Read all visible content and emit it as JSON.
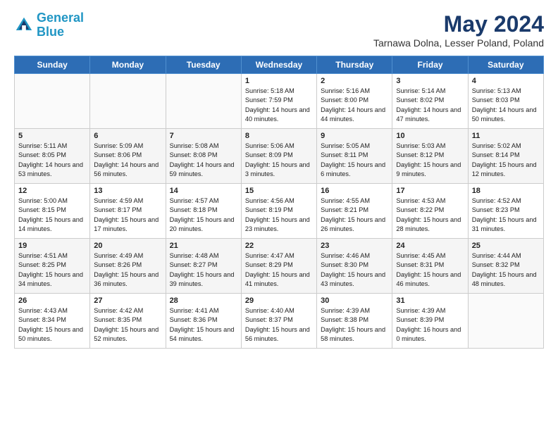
{
  "logo": {
    "line1": "General",
    "line2": "Blue"
  },
  "title": "May 2024",
  "location": "Tarnawa Dolna, Lesser Poland, Poland",
  "days_header": [
    "Sunday",
    "Monday",
    "Tuesday",
    "Wednesday",
    "Thursday",
    "Friday",
    "Saturday"
  ],
  "weeks": [
    [
      {
        "num": "",
        "sunrise": "",
        "sunset": "",
        "daylight": ""
      },
      {
        "num": "",
        "sunrise": "",
        "sunset": "",
        "daylight": ""
      },
      {
        "num": "",
        "sunrise": "",
        "sunset": "",
        "daylight": ""
      },
      {
        "num": "1",
        "sunrise": "Sunrise: 5:18 AM",
        "sunset": "Sunset: 7:59 PM",
        "daylight": "Daylight: 14 hours and 40 minutes."
      },
      {
        "num": "2",
        "sunrise": "Sunrise: 5:16 AM",
        "sunset": "Sunset: 8:00 PM",
        "daylight": "Daylight: 14 hours and 44 minutes."
      },
      {
        "num": "3",
        "sunrise": "Sunrise: 5:14 AM",
        "sunset": "Sunset: 8:02 PM",
        "daylight": "Daylight: 14 hours and 47 minutes."
      },
      {
        "num": "4",
        "sunrise": "Sunrise: 5:13 AM",
        "sunset": "Sunset: 8:03 PM",
        "daylight": "Daylight: 14 hours and 50 minutes."
      }
    ],
    [
      {
        "num": "5",
        "sunrise": "Sunrise: 5:11 AM",
        "sunset": "Sunset: 8:05 PM",
        "daylight": "Daylight: 14 hours and 53 minutes."
      },
      {
        "num": "6",
        "sunrise": "Sunrise: 5:09 AM",
        "sunset": "Sunset: 8:06 PM",
        "daylight": "Daylight: 14 hours and 56 minutes."
      },
      {
        "num": "7",
        "sunrise": "Sunrise: 5:08 AM",
        "sunset": "Sunset: 8:08 PM",
        "daylight": "Daylight: 14 hours and 59 minutes."
      },
      {
        "num": "8",
        "sunrise": "Sunrise: 5:06 AM",
        "sunset": "Sunset: 8:09 PM",
        "daylight": "Daylight: 15 hours and 3 minutes."
      },
      {
        "num": "9",
        "sunrise": "Sunrise: 5:05 AM",
        "sunset": "Sunset: 8:11 PM",
        "daylight": "Daylight: 15 hours and 6 minutes."
      },
      {
        "num": "10",
        "sunrise": "Sunrise: 5:03 AM",
        "sunset": "Sunset: 8:12 PM",
        "daylight": "Daylight: 15 hours and 9 minutes."
      },
      {
        "num": "11",
        "sunrise": "Sunrise: 5:02 AM",
        "sunset": "Sunset: 8:14 PM",
        "daylight": "Daylight: 15 hours and 12 minutes."
      }
    ],
    [
      {
        "num": "12",
        "sunrise": "Sunrise: 5:00 AM",
        "sunset": "Sunset: 8:15 PM",
        "daylight": "Daylight: 15 hours and 14 minutes."
      },
      {
        "num": "13",
        "sunrise": "Sunrise: 4:59 AM",
        "sunset": "Sunset: 8:17 PM",
        "daylight": "Daylight: 15 hours and 17 minutes."
      },
      {
        "num": "14",
        "sunrise": "Sunrise: 4:57 AM",
        "sunset": "Sunset: 8:18 PM",
        "daylight": "Daylight: 15 hours and 20 minutes."
      },
      {
        "num": "15",
        "sunrise": "Sunrise: 4:56 AM",
        "sunset": "Sunset: 8:19 PM",
        "daylight": "Daylight: 15 hours and 23 minutes."
      },
      {
        "num": "16",
        "sunrise": "Sunrise: 4:55 AM",
        "sunset": "Sunset: 8:21 PM",
        "daylight": "Daylight: 15 hours and 26 minutes."
      },
      {
        "num": "17",
        "sunrise": "Sunrise: 4:53 AM",
        "sunset": "Sunset: 8:22 PM",
        "daylight": "Daylight: 15 hours and 28 minutes."
      },
      {
        "num": "18",
        "sunrise": "Sunrise: 4:52 AM",
        "sunset": "Sunset: 8:23 PM",
        "daylight": "Daylight: 15 hours and 31 minutes."
      }
    ],
    [
      {
        "num": "19",
        "sunrise": "Sunrise: 4:51 AM",
        "sunset": "Sunset: 8:25 PM",
        "daylight": "Daylight: 15 hours and 34 minutes."
      },
      {
        "num": "20",
        "sunrise": "Sunrise: 4:49 AM",
        "sunset": "Sunset: 8:26 PM",
        "daylight": "Daylight: 15 hours and 36 minutes."
      },
      {
        "num": "21",
        "sunrise": "Sunrise: 4:48 AM",
        "sunset": "Sunset: 8:27 PM",
        "daylight": "Daylight: 15 hours and 39 minutes."
      },
      {
        "num": "22",
        "sunrise": "Sunrise: 4:47 AM",
        "sunset": "Sunset: 8:29 PM",
        "daylight": "Daylight: 15 hours and 41 minutes."
      },
      {
        "num": "23",
        "sunrise": "Sunrise: 4:46 AM",
        "sunset": "Sunset: 8:30 PM",
        "daylight": "Daylight: 15 hours and 43 minutes."
      },
      {
        "num": "24",
        "sunrise": "Sunrise: 4:45 AM",
        "sunset": "Sunset: 8:31 PM",
        "daylight": "Daylight: 15 hours and 46 minutes."
      },
      {
        "num": "25",
        "sunrise": "Sunrise: 4:44 AM",
        "sunset": "Sunset: 8:32 PM",
        "daylight": "Daylight: 15 hours and 48 minutes."
      }
    ],
    [
      {
        "num": "26",
        "sunrise": "Sunrise: 4:43 AM",
        "sunset": "Sunset: 8:34 PM",
        "daylight": "Daylight: 15 hours and 50 minutes."
      },
      {
        "num": "27",
        "sunrise": "Sunrise: 4:42 AM",
        "sunset": "Sunset: 8:35 PM",
        "daylight": "Daylight: 15 hours and 52 minutes."
      },
      {
        "num": "28",
        "sunrise": "Sunrise: 4:41 AM",
        "sunset": "Sunset: 8:36 PM",
        "daylight": "Daylight: 15 hours and 54 minutes."
      },
      {
        "num": "29",
        "sunrise": "Sunrise: 4:40 AM",
        "sunset": "Sunset: 8:37 PM",
        "daylight": "Daylight: 15 hours and 56 minutes."
      },
      {
        "num": "30",
        "sunrise": "Sunrise: 4:39 AM",
        "sunset": "Sunset: 8:38 PM",
        "daylight": "Daylight: 15 hours and 58 minutes."
      },
      {
        "num": "31",
        "sunrise": "Sunrise: 4:39 AM",
        "sunset": "Sunset: 8:39 PM",
        "daylight": "Daylight: 16 hours and 0 minutes."
      },
      {
        "num": "",
        "sunrise": "",
        "sunset": "",
        "daylight": ""
      }
    ]
  ]
}
